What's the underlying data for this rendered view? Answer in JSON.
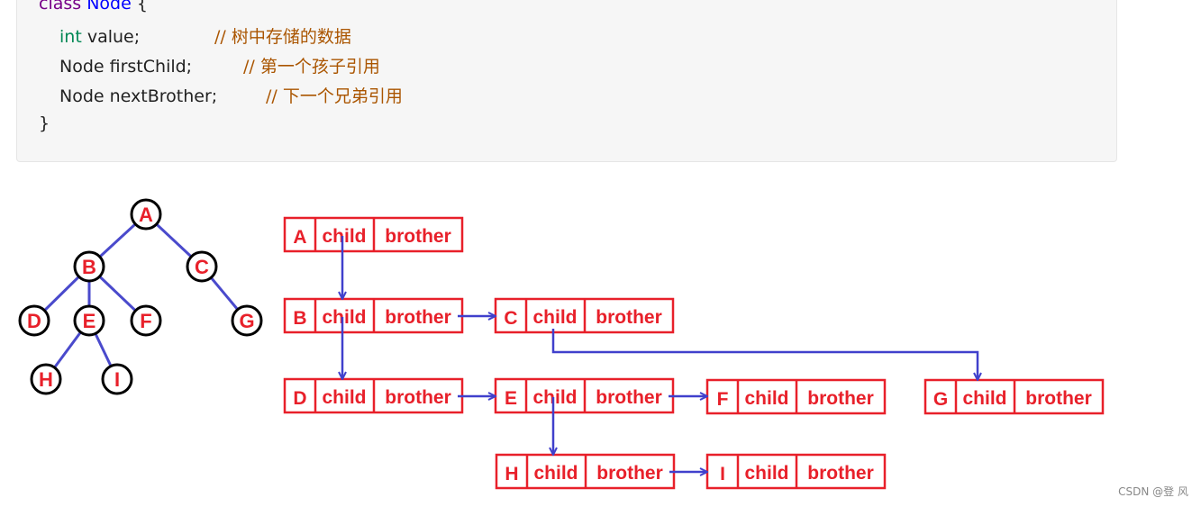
{
  "code": {
    "line1": {
      "keyword": "class",
      "type": "Node",
      "rest": " {"
    },
    "line2": {
      "type": "int",
      "rest": " value;",
      "comment": "// 树中存储的数据"
    },
    "line3": {
      "rest": "Node firstChild;",
      "comment": "// 第一个孩子引用"
    },
    "line4": {
      "rest": "Node nextBrother;",
      "comment": "// 下一个兄弟引用"
    },
    "line5": "}"
  },
  "tree": {
    "nodes": [
      "A",
      "B",
      "C",
      "D",
      "E",
      "F",
      "G",
      "H",
      "I"
    ],
    "edges": [
      [
        "A",
        "B"
      ],
      [
        "A",
        "C"
      ],
      [
        "B",
        "D"
      ],
      [
        "B",
        "E"
      ],
      [
        "B",
        "F"
      ],
      [
        "C",
        "G"
      ],
      [
        "E",
        "H"
      ],
      [
        "E",
        "I"
      ]
    ]
  },
  "list": {
    "child_label": "child",
    "brother_label": "brother",
    "nodes": [
      "A",
      "B",
      "C",
      "D",
      "E",
      "F",
      "G",
      "H",
      "I"
    ],
    "links": [
      {
        "from": "A",
        "to": "B",
        "type": "child"
      },
      {
        "from": "B",
        "to": "C",
        "type": "brother"
      },
      {
        "from": "B",
        "to": "D",
        "type": "child"
      },
      {
        "from": "C",
        "to": "G",
        "type": "child"
      },
      {
        "from": "D",
        "to": "E",
        "type": "brother"
      },
      {
        "from": "E",
        "to": "F",
        "type": "brother"
      },
      {
        "from": "E",
        "to": "H",
        "type": "child"
      },
      {
        "from": "H",
        "to": "I",
        "type": "brother"
      }
    ]
  },
  "colors": {
    "box": "#e8202a",
    "arrow": "#4040cc",
    "edge": "#4a4acc"
  },
  "watermark": "CSDN @登 风"
}
